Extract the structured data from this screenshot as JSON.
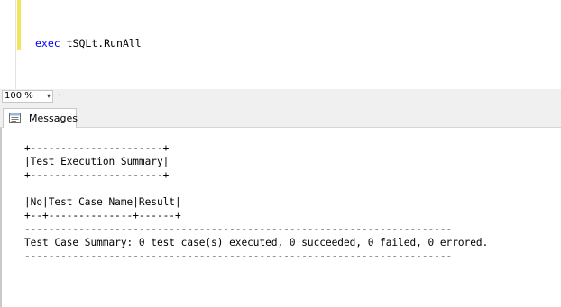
{
  "editor": {
    "keyword": "exec",
    "statement": " tSQLt.RunAll"
  },
  "zoom": {
    "value": "100 %",
    "dropdown_glyph": "▾",
    "scroll_left_glyph": "‹"
  },
  "results_tabs": [
    {
      "label": "Messages",
      "icon": "messages-icon"
    }
  ],
  "messages": [
    "+----------------------+",
    "|Test Execution Summary|",
    "+----------------------+",
    "",
    "|No|Test Case Name|Result|",
    "+--+--------------+------+",
    "-----------------------------------------------------------------------",
    "Test Case Summary: 0 test case(s) executed, 0 succeeded, 0 failed, 0 errored.",
    "-----------------------------------------------------------------------"
  ],
  "colors": {
    "keyword": "#0000ff",
    "change_bar": "#f2e35a",
    "chrome": "#f0f0f0"
  }
}
